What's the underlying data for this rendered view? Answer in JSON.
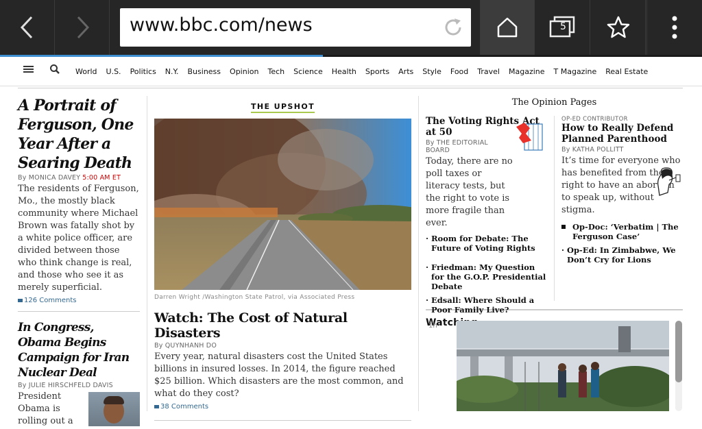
{
  "browser": {
    "url": "www.bbc.com/news",
    "tab_count": "5",
    "load_progress": 0.46
  },
  "nav": {
    "sections": [
      "World",
      "U.S.",
      "Politics",
      "N.Y.",
      "Business",
      "Opinion",
      "Tech",
      "Science",
      "Health",
      "Sports",
      "Arts",
      "Style",
      "Food",
      "Travel",
      "Magazine",
      "T Magazine",
      "Real Estate"
    ]
  },
  "col1": {
    "story1": {
      "headline": "A Portrait of Ferguson, One Year After a Searing Death",
      "byline": "By MONICA DAVEY",
      "time": "5:00 AM ET",
      "summary": "The residents of Ferguson, Mo., the mostly black community where Michael Brown was fatally shot by a white police officer, are divided between those who think change is real, and those who see it as merely superficial.",
      "comments": "126 Comments"
    },
    "story2": {
      "headline": "In Congress, Obama Begins Campaign for Iran Nuclear Deal",
      "byline": "By JULIE HIRSCHFELD DAVIS",
      "summary": "President Obama is rolling out a"
    }
  },
  "col2": {
    "kicker": "THE UPSHOT",
    "photo_credit": "Darren Wright /Washington State Patrol, via Associated Press",
    "headline": "Watch: The Cost of Natural Disasters",
    "byline": "By QUYNHANH DO",
    "summary": "Every year, natural disasters cost the United States billions in insured losses. In 2014, the figure reached $25 billion. Which disasters are the most common, and what do they cost?",
    "comments": "38 Comments"
  },
  "opinion": {
    "title": "The Opinion Pages",
    "left": {
      "headline": "The Voting Rights Act at 50",
      "byline": "By THE EDITORIAL BOARD",
      "summary": "Today, there are no poll taxes or literacy tests, but the right to vote is more fragile than ever.",
      "bullets": [
        "Room for Debate: The Future of Voting Rights",
        "Friedman: My Question for the G.O.P. Presidential Debate",
        "Edsall: Where Should a Poor Family Live?"
      ]
    },
    "right": {
      "kicker": "OP-ED CONTRIBUTOR",
      "headline": "How to Really Defend Planned Parenthood",
      "byline": "By KATHA POLLITT",
      "summary": "It’s time for everyone who has benefited from the right to have an abortion to speak up, without stigma.",
      "bullets": [
        "Op-Doc: ‘Verbatim | The Ferguson Case’",
        "Op-Ed: In Zimbabwe, We Don’t Cry for Lions"
      ]
    }
  },
  "watching": {
    "title": "Watching",
    "time": "1h"
  }
}
